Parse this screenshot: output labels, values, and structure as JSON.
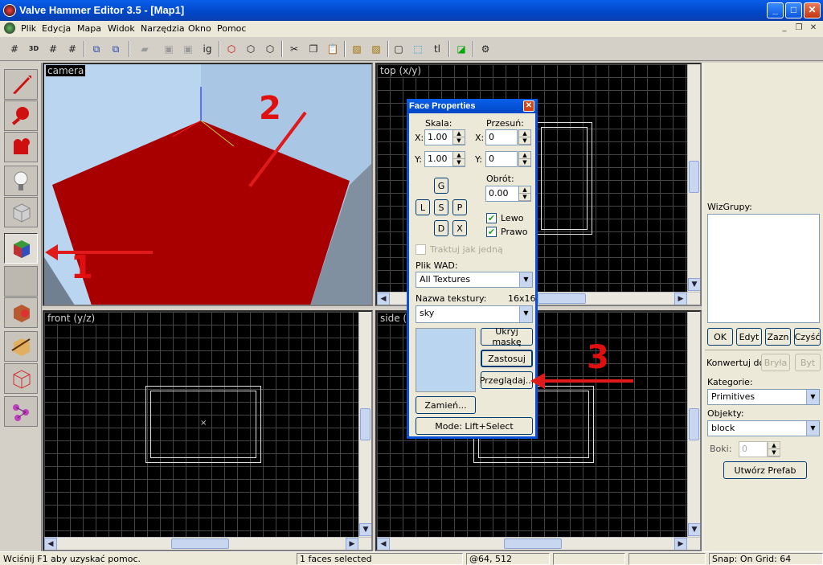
{
  "window": {
    "title": "Valve Hammer Editor 3.5 - [Map1]",
    "buttons": {
      "minimize": "_",
      "maximize": "□",
      "close": "✕"
    }
  },
  "menu": {
    "items": [
      "Plik",
      "Edycja",
      "Mapa",
      "Widok",
      "Narzędzia",
      "Okno",
      "Pomoc"
    ]
  },
  "toolbar": {
    "ig": "ig",
    "tl": "tl"
  },
  "viewports": {
    "camera": "camera",
    "top": "top (x/y)",
    "front": "front (y/z)",
    "side": "side ("
  },
  "face_properties": {
    "title": "Face Properties",
    "skala_label": "Skala:",
    "przesun_label": "Przesuń:",
    "x_label": "X:",
    "y_label": "Y:",
    "scale_x": "1.00",
    "scale_y": "1.00",
    "shift_x": "0",
    "shift_y": "0",
    "obrot_label": "Obrót:",
    "rotation": "0.00",
    "btn_g": "G",
    "btn_l": "L",
    "btn_s": "S",
    "btn_p": "P",
    "btn_d": "D",
    "btn_x": "X",
    "lewo": "Lewo",
    "prawo": "Prawo",
    "traktuj": "Traktuj jak jedną",
    "wad_label": "Plik WAD:",
    "wad_value": "All Textures",
    "texname_label": "Nazwa tekstury:",
    "tex_size": "16x16",
    "tex_value": "sky",
    "ukryj": "Ukryj maskę",
    "zastosuj": "Zastosuj",
    "przegladaj": "Przeglądaj...",
    "zamien": "Zamień...",
    "mode": "Mode: Lift+Select"
  },
  "right_panel": {
    "wizgrupy_label": "WizGrupy:",
    "ok": "OK",
    "edyt": "Edyt",
    "zazn": "Zazn",
    "czysc": "Czyść",
    "konwertuj": "Konwertuj do:",
    "bryla": "Bryła",
    "byt": "Byt",
    "kategorie_label": "Kategorie:",
    "kategorie_value": "Primitives",
    "obiekty_label": "Objekty:",
    "obiekty_value": "block",
    "boki_label": "Boki:",
    "boki_value": "0",
    "utworz": "Utwórz Prefab"
  },
  "annotations": {
    "n1": "1",
    "n2": "2",
    "n3": "3"
  },
  "status": {
    "help": "Wciśnij F1 aby uzyskać pomoc.",
    "selected": "1 faces selected",
    "coords": "@64, 512",
    "snap": "Snap: On Grid: 64"
  },
  "colors": {
    "face_red": "#a80000",
    "sky": "#b9d5f0",
    "annotation": "#e01010"
  }
}
